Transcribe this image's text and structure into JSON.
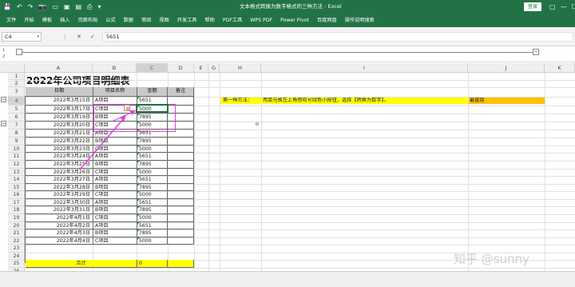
{
  "titlebar": {
    "title": "文本格式转换为数字格式的三种方法 - Excel",
    "login": "登录",
    "qa_icons": [
      "save-icon",
      "undo-icon",
      "redo-icon",
      "camera-icon",
      "file-icon",
      "image-icon",
      "paste-icon",
      "print-icon",
      "chevron-down-icon"
    ],
    "qa_glyphs": [
      "💾",
      "↶",
      "↷",
      "📷",
      "▭",
      "▣",
      "▤",
      "⎙",
      "▾"
    ],
    "win_glyphs": [
      "▢",
      "—",
      "☐",
      "✕"
    ]
  },
  "ribbon": {
    "tabs": [
      "文件",
      "开始",
      "模板",
      "插入",
      "页面布局",
      "公式",
      "数据",
      "审阅",
      "视图",
      "开发工具",
      "帮助",
      "PDF工具",
      "WPS PDF",
      "Power Pivot",
      "百度网盘",
      "操作说明搜索"
    ]
  },
  "formula_bar": {
    "name_box": "C4",
    "name_box_arrow": "▾",
    "icons": [
      "⋮",
      "✕",
      "✓",
      "fx"
    ],
    "value": "5651"
  },
  "outline": {
    "levels": [
      "1",
      "2"
    ]
  },
  "columns": [
    "A",
    "B",
    "C",
    "D",
    "E",
    "G",
    "H",
    "I",
    "J",
    "K"
  ],
  "rows": [
    "1",
    "2",
    "3",
    "4",
    "5",
    "6",
    "7",
    "8",
    "9",
    "10",
    "11",
    "12",
    "13",
    "14",
    "15",
    "16",
    "17",
    "18",
    "19",
    "20",
    "21",
    "22",
    "23",
    "24",
    "25",
    "26",
    "27"
  ],
  "sheet": {
    "title": "2022年公司项目明细表",
    "headers": [
      "日期",
      "项目名称",
      "金额",
      "备注"
    ],
    "records": [
      [
        "2022年3月15日",
        "A项目",
        "5651"
      ],
      [
        "2022年3月17日",
        "C项目",
        "5000"
      ],
      [
        "2022年3月19日",
        "B项目",
        "7895"
      ],
      [
        "2022年3月20日",
        "C项目",
        "5000"
      ],
      [
        "2022年3月21日",
        "A项目",
        "5651"
      ],
      [
        "2022年3月22日",
        "B项目",
        "7895"
      ],
      [
        "2022年3月23日",
        "C项目",
        "5000"
      ],
      [
        "2022年3月24日",
        "A项目",
        "5651"
      ],
      [
        "2022年3月25日",
        "B项目",
        "7895"
      ],
      [
        "2022年3月26日",
        "C项目",
        "5000"
      ],
      [
        "2022年3月27日",
        "A项目",
        "5651"
      ],
      [
        "2022年3月28日",
        "B项目",
        "7895"
      ],
      [
        "2022年3月29日",
        "C项目",
        "5000"
      ],
      [
        "2022年3月30日",
        "A项目",
        "5651"
      ],
      [
        "2022年3月31日",
        "B项目",
        "7895"
      ],
      [
        "2022年4月1日",
        "C项目",
        "5000"
      ],
      [
        "2022年4月2日",
        "A项目",
        "5651"
      ],
      [
        "2022年4月3日",
        "B项目",
        "7895"
      ],
      [
        "2022年4月4日",
        "C项目",
        "5000"
      ]
    ],
    "total_label": "合计",
    "total_value": "0",
    "method_label": "第一种方法：",
    "method_text": "用单元格左上角感叹号绿色小按钮，选择【转换为数字】。",
    "simplest": "最直接",
    "h7_value": "0"
  },
  "watermark": "知乎 @sunny",
  "colors": {
    "excel_green": "#217346",
    "highlight_yellow": "#ffff00",
    "orange": "#ffc000",
    "annotation_magenta": "#e040e0"
  }
}
